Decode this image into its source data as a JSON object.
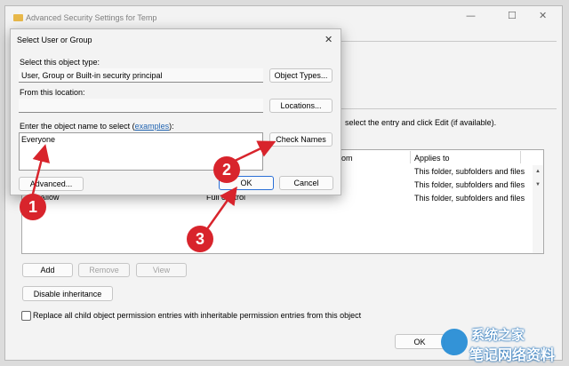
{
  "parent_window": {
    "title": "Advanced Security Settings for Temp",
    "right_text": "select the entry and click Edit (if available).",
    "table": {
      "headers": [
        "d from",
        "Applies to"
      ],
      "rows": [
        {
          "type": "",
          "principal": "",
          "access": "",
          "applies": "This folder, subfolders and files"
        },
        {
          "type": "",
          "principal": "",
          "access": "",
          "applies": "This folder, subfolders and files"
        },
        {
          "type": "Allow",
          "principal": "",
          "access": "Full control",
          "applies": "This folder, subfolders and files"
        }
      ]
    },
    "add_label": "Add",
    "remove_label": "Remove",
    "view_label": "View",
    "disable_inheritance_label": "Disable inheritance",
    "replace_checkbox_label": "Replace all child object permission entries with inheritable permission entries from this object",
    "ok_label": "OK"
  },
  "dialog": {
    "title": "Select User or Group",
    "object_type_label": "Select this object type:",
    "object_type_value": "User, Group or Built-in security principal",
    "object_types_button": "Object Types...",
    "location_label": "From this location:",
    "location_value": "",
    "locations_button": "Locations...",
    "enter_label_prefix": "Enter the object name to select (",
    "examples_link": "examples",
    "enter_label_suffix": "):",
    "object_name_value": "Everyone",
    "check_names_button": "Check Names",
    "advanced_button": "Advanced...",
    "ok_button": "OK",
    "cancel_button": "Cancel"
  },
  "annotations": {
    "step1": "1",
    "step2": "2",
    "step3": "3",
    "color": "#d8242c"
  },
  "watermark": {
    "text": "系统之家",
    "text2": "笔记网络资料"
  }
}
